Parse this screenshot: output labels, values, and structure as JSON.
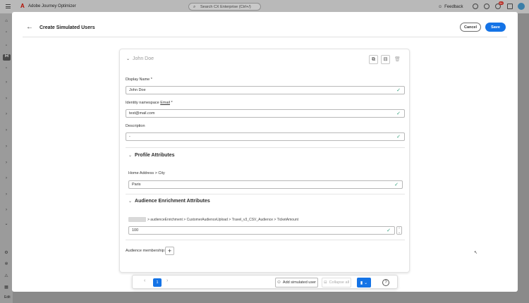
{
  "app": {
    "name": "Adobe Journey Optimizer",
    "search_placeholder": "Search CX Enterprise (Ctrl+/)",
    "feedback_label": "Feedback",
    "notification_count": "9+",
    "edit_label": "Edit"
  },
  "modal": {
    "title": "Create Simulated Users",
    "cancel_label": "Cancel",
    "save_label": "Save"
  },
  "user_card": {
    "name": "John Doe",
    "display_name_label": "Display Name",
    "required_mark": "*",
    "display_name_value": "John Doe",
    "identity_label_prefix": "Identity namespace",
    "identity_namespace": "Email",
    "identity_value": "test@mail.com",
    "description_label": "Description",
    "description_value": "-",
    "profile_section_title": "Profile Attributes",
    "profile_attr_path": "Home Address > City",
    "profile_attr_value": "Paris",
    "audience_section_title": "Audience Enrichment Attributes",
    "audience_attr_path": "> audienceEnrichment > CustomerAudienceUpload > Travel_v3_CSV_Audience > TicketAmount",
    "audience_attr_value": "100",
    "membership_label": "Audience membership:"
  },
  "bottom_bar": {
    "current_page": "1",
    "add_user_label": "Add simulated user",
    "collapse_label": "Collapse all"
  },
  "colors": {
    "accent": "#1473e6",
    "valid": "#2d9d78"
  }
}
